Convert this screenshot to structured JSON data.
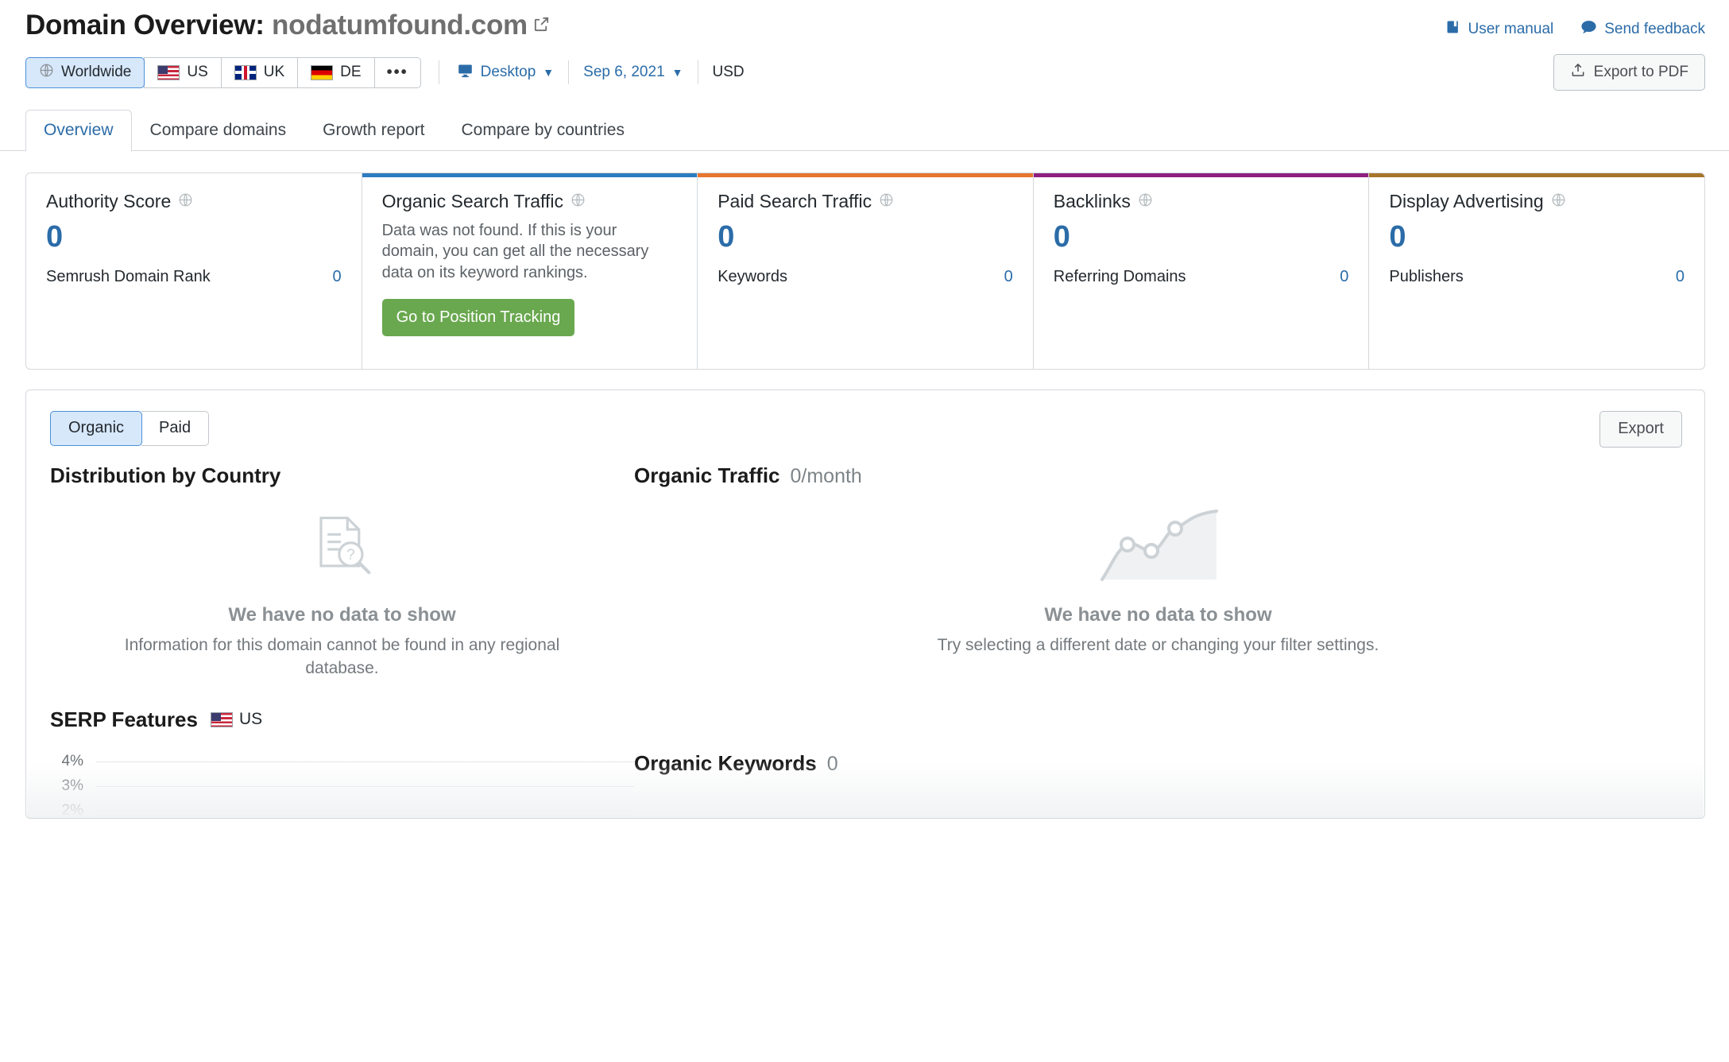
{
  "header": {
    "title_prefix": "Domain Overview:",
    "domain": "nodatumfound.com",
    "external_link_icon": "external-link-icon",
    "links": [
      {
        "label": "User manual",
        "icon": "book-icon"
      },
      {
        "label": "Send feedback",
        "icon": "speech-bubble-icon"
      }
    ]
  },
  "filter_bar": {
    "databases": [
      {
        "label": "Worldwide",
        "icon": "globe-icon",
        "active": true
      },
      {
        "label": "US",
        "icon": "flag-us-icon",
        "active": false
      },
      {
        "label": "UK",
        "icon": "flag-uk-icon",
        "active": false
      },
      {
        "label": "DE",
        "icon": "flag-de-icon",
        "active": false
      },
      {
        "label": "•••",
        "icon": "more-icon",
        "active": false
      }
    ],
    "device": "Desktop",
    "date": "Sep 6, 2021",
    "currency": "USD",
    "export_pdf": "Export to PDF"
  },
  "tabs": [
    {
      "label": "Overview",
      "active": true
    },
    {
      "label": "Compare domains",
      "active": false
    },
    {
      "label": "Growth report",
      "active": false
    },
    {
      "label": "Compare by countries",
      "active": false
    }
  ],
  "cards": [
    {
      "title": "Authority Score",
      "accent": "#ffffff",
      "value": "0",
      "foot_label": "Semrush Domain Rank",
      "foot_value": "0"
    },
    {
      "title": "Organic Search Traffic",
      "accent": "#2b7cc0",
      "note": "Data was not found. If this is your domain, you can get all the necessary data on its keyword rankings.",
      "cta": "Go to Position Tracking"
    },
    {
      "title": "Paid Search Traffic",
      "accent": "#e8752e",
      "value": "0",
      "foot_label": "Keywords",
      "foot_value": "0"
    },
    {
      "title": "Backlinks",
      "accent": "#8f2080",
      "value": "0",
      "foot_label": "Referring Domains",
      "foot_value": "0"
    },
    {
      "title": "Display Advertising",
      "accent": "#a8742a",
      "value": "0",
      "foot_label": "Publishers",
      "foot_value": "0"
    }
  ],
  "lower": {
    "toggle": [
      {
        "label": "Organic",
        "active": true
      },
      {
        "label": "Paid",
        "active": false
      }
    ],
    "export_label": "Export",
    "distribution": {
      "heading": "Distribution by Country",
      "empty_title": "We have no data to show",
      "empty_sub": "Information for this domain cannot be found in any regional database.",
      "empty_icon": "document-search-icon"
    },
    "organic_traffic": {
      "heading": "Organic Traffic",
      "value": "0/month",
      "empty_title": "We have no data to show",
      "empty_sub": "Try selecting a different date or changing your filter settings.",
      "empty_icon": "line-chart-icon"
    },
    "serp_features": {
      "heading": "SERP Features",
      "country": "US",
      "country_icon": "flag-us-icon"
    },
    "organic_keywords": {
      "heading": "Organic Keywords",
      "value": "0"
    }
  },
  "chart_data": {
    "type": "line",
    "title": "SERP Features",
    "xlabel": "",
    "ylabel": "",
    "categories": [],
    "series": [],
    "ytick_labels": [
      "4%",
      "3%",
      "2%"
    ],
    "ytick_values": [
      4,
      3,
      2
    ],
    "ylim": [
      2,
      4
    ],
    "grid": true,
    "legend": "none",
    "note": "Empty chart — no data series rendered; only horizontal gridlines at 4%, 3%, 2% are visible."
  }
}
